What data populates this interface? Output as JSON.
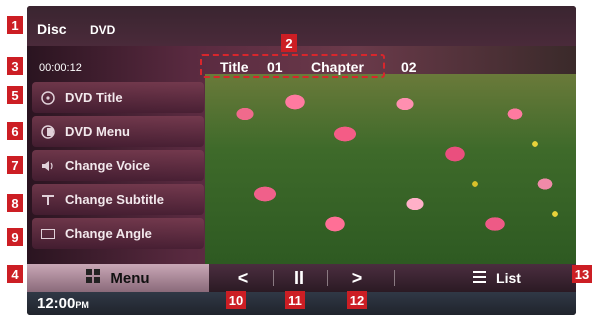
{
  "header": {
    "disc_label": "Disc",
    "disc_type": "DVD"
  },
  "playback": {
    "elapsed": "00:00:12",
    "title_label": "Title",
    "title_number": "01",
    "chapter_label": "Chapter",
    "chapter_number": "02"
  },
  "side_menu": {
    "dvd_title": "DVD Title",
    "dvd_menu": "DVD Menu",
    "change_voice": "Change Voice",
    "change_subtitle": "Change Subtitle",
    "change_angle": "Change Angle"
  },
  "controls": {
    "menu": "Menu",
    "prev": "<",
    "pause": "II",
    "next": ">",
    "list": "List"
  },
  "status": {
    "clock": "12:00",
    "clock_suffix": "PM"
  },
  "markers": [
    "1",
    "2",
    "3",
    "4",
    "5",
    "6",
    "7",
    "8",
    "9",
    "10",
    "11",
    "12",
    "13"
  ],
  "colors": {
    "marker": "#cc1e24",
    "title_box": "#d8262c"
  }
}
